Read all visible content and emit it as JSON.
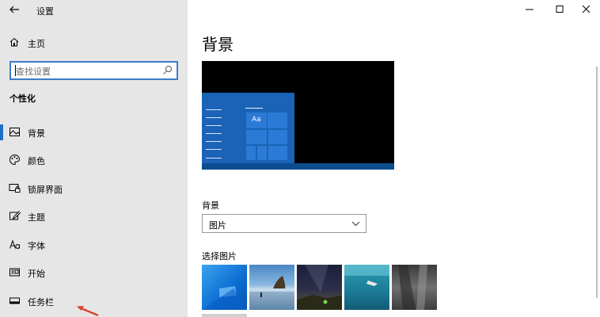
{
  "app": {
    "title": "设置"
  },
  "sidebar": {
    "home_label": "主页",
    "search_placeholder": "查找设置",
    "section_title": "个性化",
    "items": [
      {
        "label": "背景",
        "icon": "picture-icon",
        "active": true
      },
      {
        "label": "颜色",
        "icon": "palette-icon"
      },
      {
        "label": "锁屏界面",
        "icon": "lock-screen-icon"
      },
      {
        "label": "主题",
        "icon": "theme-brush-icon"
      },
      {
        "label": "字体",
        "icon": "font-icon"
      },
      {
        "label": "开始",
        "icon": "start-icon"
      },
      {
        "label": "任务栏",
        "icon": "taskbar-icon"
      }
    ]
  },
  "main": {
    "title": "背景",
    "preview_tile_text": "Aa",
    "background_label": "背景",
    "background_value": "图片",
    "choose_picture_label": "选择图片"
  },
  "colors": {
    "accent": "#1f6fc9",
    "sidebar_bg": "#e6e6e6",
    "annotation_arrow": "#d9432f"
  }
}
